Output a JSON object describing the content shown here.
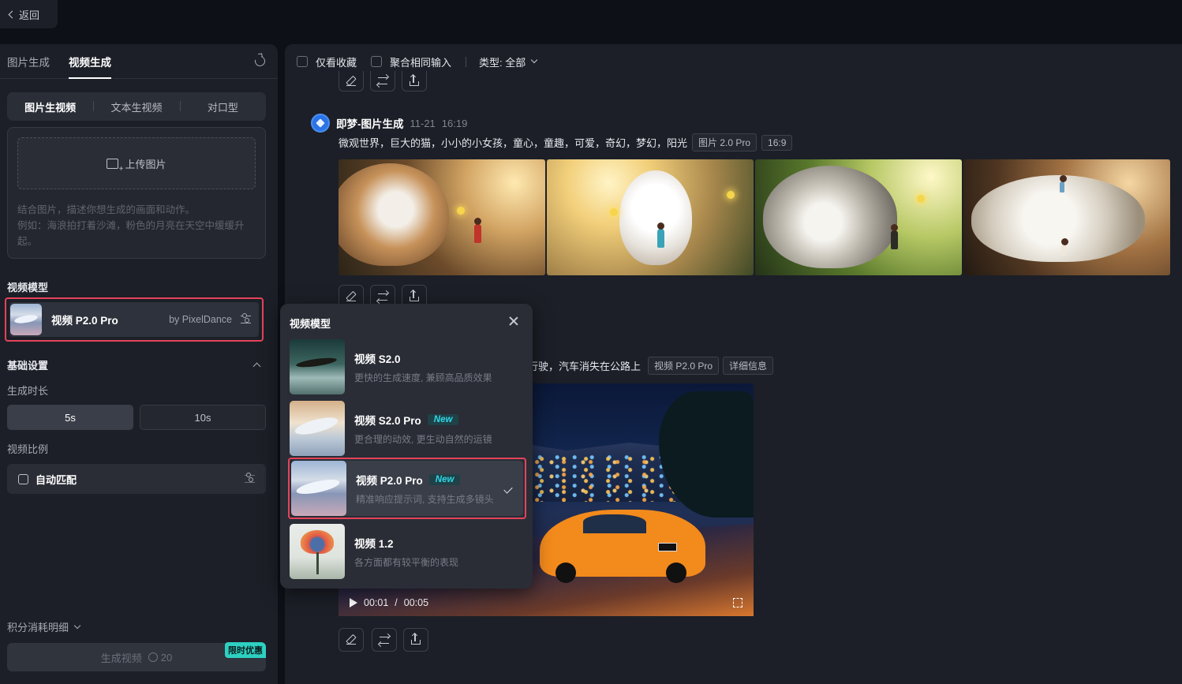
{
  "back": {
    "label": "返回"
  },
  "left_panel": {
    "tabs": [
      {
        "label": "图片生成",
        "active": false
      },
      {
        "label": "视频生成",
        "active": true
      }
    ],
    "sub_tabs": [
      {
        "label": "图片生视频",
        "active": true
      },
      {
        "label": "文本生视频",
        "active": false
      },
      {
        "label": "对口型",
        "active": false
      }
    ],
    "upload_label": "上传图片",
    "prompt_hint": "结合图片，描述你想生成的画面和动作。\n例如：海浪拍打着沙滩，粉色的月亮在天空中缓缓升起。",
    "model_section_title": "视频模型",
    "selected_model": {
      "name": "视频 P2.0 Pro",
      "by": "by PixelDance"
    },
    "basic_settings_title": "基础设置",
    "duration_label": "生成时长",
    "durations": [
      {
        "label": "5s",
        "selected": true
      },
      {
        "label": "10s",
        "selected": false
      }
    ],
    "ratio_label": "视频比例",
    "ratio_value": "自动匹配",
    "credits_label": "积分消耗明细",
    "generate_label": "生成视频",
    "generate_cost": "20",
    "promo_badge": "限时优惠"
  },
  "filter_bar": {
    "favorites_only": "仅看收藏",
    "group_same_input": "聚合相同输入",
    "type_filter": "类型: 全部"
  },
  "image_entry": {
    "title": "即梦-图片生成",
    "date": "11-21",
    "time": "16:19",
    "prompt": "微观世界，巨大的猫，小小的小女孩，童心，童趣，可爱，奇幻，梦幻，阳光",
    "tags": [
      "图片 2.0 Pro",
      "16:9"
    ]
  },
  "video_entry": {
    "prompt_tail": "行驶，汽车消失在公路上",
    "tags": [
      "视频 P2.0 Pro",
      "详细信息"
    ],
    "current_time": "00:01",
    "duration": "00:05"
  },
  "model_dropdown": {
    "title": "视频模型",
    "new_label": "New",
    "items": [
      {
        "name": "视频 S2.0",
        "desc": "更快的生成速度, 兼顾高品质效果",
        "is_new": false,
        "selected": false,
        "thumb": "whale-dark"
      },
      {
        "name": "视频 S2.0 Pro",
        "desc": "更合理的动效, 更生动自然的运镜",
        "is_new": true,
        "selected": false,
        "thumb": "whale-light"
      },
      {
        "name": "视频 P2.0 Pro",
        "desc": "精准响应提示词, 支持生成多镜头",
        "is_new": true,
        "selected": true,
        "thumb": "whale-pink"
      },
      {
        "name": "视频 1.2",
        "desc": "各方面都有较平衡的表现",
        "is_new": false,
        "selected": false,
        "thumb": "flower"
      }
    ]
  },
  "colors": {
    "accent_new": "#2fd8e6",
    "highlight_outline": "#e5435a",
    "promo": "#2ed1c1"
  }
}
